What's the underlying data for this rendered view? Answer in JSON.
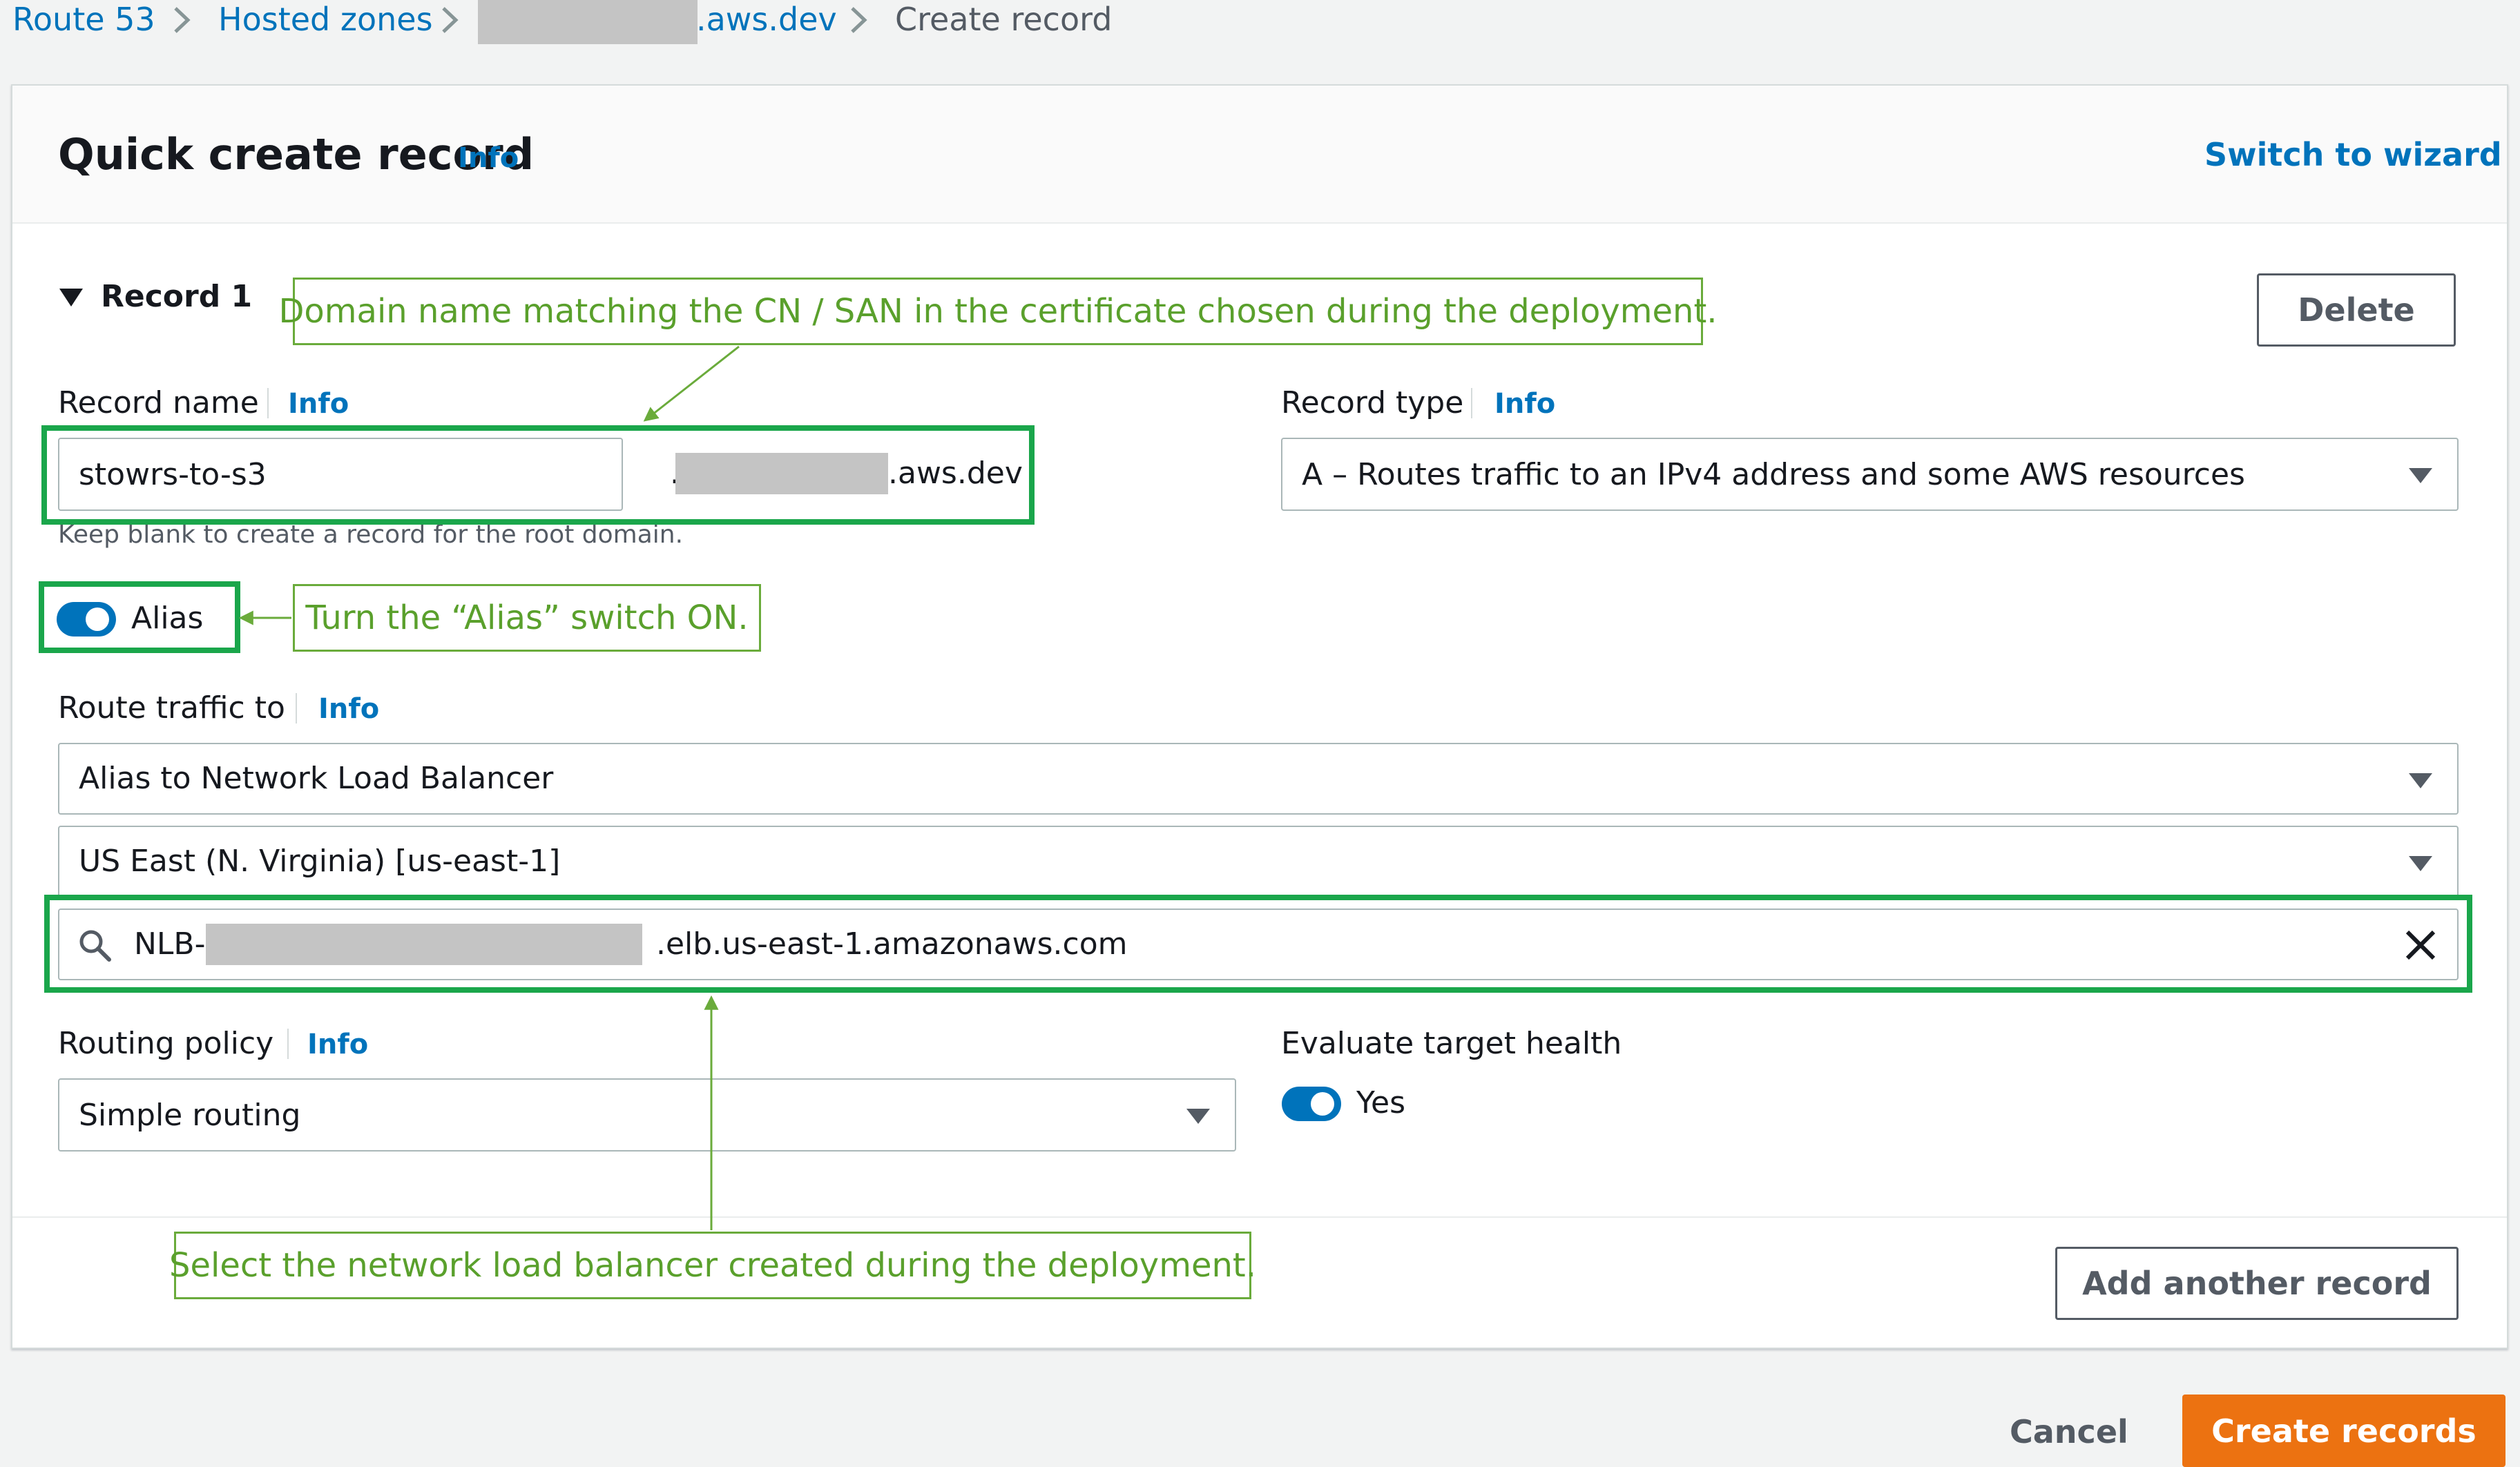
{
  "breadcrumb": {
    "route53": "Route 53",
    "hosted_zones": "Hosted zones",
    "zone_suffix": ".aws.dev",
    "current": "Create record"
  },
  "header": {
    "title": "Quick create record",
    "info": "Info",
    "switch_wizard": "Switch to wizard"
  },
  "record": {
    "section_title": "Record 1",
    "delete_label": "Delete",
    "record_name": {
      "label": "Record name",
      "info": "Info",
      "value": "stowrs-to-s3",
      "domain_prefix": ".",
      "domain_suffix": ".aws.dev",
      "hint": "Keep blank to create a record for the root domain."
    },
    "record_type": {
      "label": "Record type",
      "info": "Info",
      "value": "A – Routes traffic to an IPv4 address and some AWS resources"
    },
    "alias": {
      "label": "Alias",
      "on": true
    },
    "route_traffic": {
      "label": "Route traffic to",
      "info": "Info",
      "endpoint": "Alias to Network Load Balancer",
      "region": "US East (N. Virginia) [us-east-1]",
      "lb_prefix": "NLB-",
      "lb_suffix": ".elb.us-east-1.amazonaws.com"
    },
    "routing_policy": {
      "label": "Routing policy",
      "info": "Info",
      "value": "Simple routing"
    },
    "health": {
      "label": "Evaluate target health",
      "value": "Yes",
      "on": true
    },
    "add_another": "Add another record"
  },
  "footer": {
    "cancel": "Cancel",
    "create": "Create records"
  },
  "annotations": {
    "domain": "Domain name matching the CN / SAN in the certificate chosen during the deployment.",
    "alias": "Turn the “Alias” switch ON.",
    "nlb": "Select the network load balancer created during the deployment."
  },
  "colors": {
    "link": "#0073bb",
    "primary": "#ec7211",
    "highlight": "#1aa64b",
    "callout": "#5aa02c"
  }
}
